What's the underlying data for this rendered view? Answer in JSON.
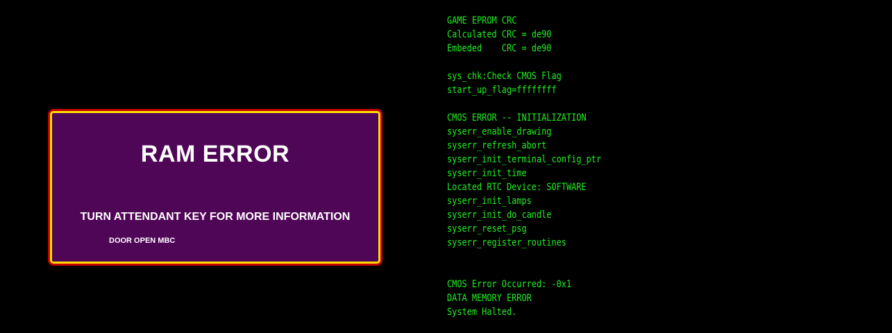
{
  "error_panel": {
    "title": "RAM ERROR",
    "instruction": "TURN ATTENDANT KEY FOR MORE INFORMATION",
    "status": "DOOR OPEN MBC"
  },
  "console": {
    "lines": [
      "GAME EPROM CRC",
      "Calculated CRC = de90",
      "Embeded    CRC = de90",
      "",
      "sys_chk:Check CMOS Flag",
      "start_up_flag=ffffffff",
      "",
      "CMOS ERROR -- INITIALIZATION",
      "syserr_enable_drawing",
      "syserr_refresh_abort",
      "syserr_init_terminal_config_ptr",
      "syserr_init_time",
      "Located RTC Device: SOFTWARE",
      "syserr_init_lamps",
      "syserr_init_do_candle",
      "syserr_reset_psg",
      "syserr_register_routines",
      "",
      "",
      "CMOS Error Occurred: -0x1",
      "DATA MEMORY ERROR",
      "System Halted."
    ]
  },
  "colors": {
    "panel_background": "#4f0657",
    "panel_border_inner": "#ffdd00",
    "panel_border_outer": "#c40000",
    "console_text": "#22ee22",
    "screen_background": "#000000"
  }
}
